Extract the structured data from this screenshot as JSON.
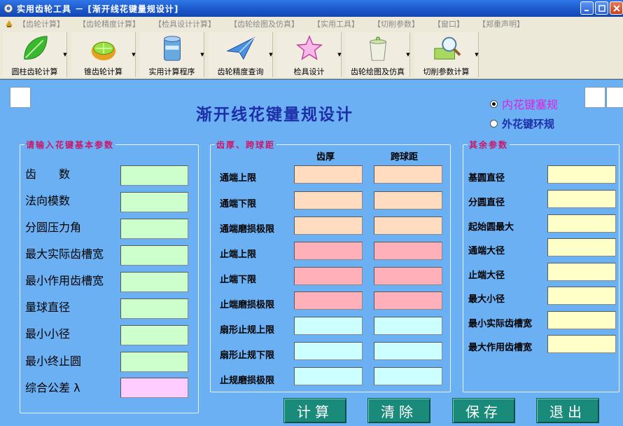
{
  "window": {
    "title": "实用齿轮工具 － [渐开线花键量规设计]",
    "colors": {
      "titlebar": "#1a56c9",
      "main_bg": "#6cb0f4",
      "title_text": "#1c2fa8"
    }
  },
  "menu": {
    "items": [
      "【齿轮计算】",
      "【齿轮精度计算】",
      "【检具设计计算】",
      "【齿轮绘图及仿真】",
      "【实用工具】",
      "【切削参数】",
      "【窗口】",
      "【郑重声明】"
    ]
  },
  "toolbar": {
    "buttons": [
      {
        "label": "圆柱齿轮计算",
        "icon": "green-leaf-icon"
      },
      {
        "label": "锥齿轮计算",
        "icon": "lime-fruit-icon"
      },
      {
        "label": "实用计算程序",
        "icon": "bin-icon"
      },
      {
        "label": "齿轮精度查询",
        "icon": "paper-plane-icon"
      },
      {
        "label": "检具设计",
        "icon": "star-icon"
      },
      {
        "label": "齿轮绘图及仿真",
        "icon": "cup-icon"
      },
      {
        "label": "切削参数计算",
        "icon": "magnifier-book-icon"
      }
    ]
  },
  "main": {
    "page_title": "渐开线花键量规设计",
    "radios": [
      {
        "label": "内花键塞规",
        "selected": true,
        "color": "#e020e0"
      },
      {
        "label": "外花键环规",
        "selected": false,
        "color": "#1c2fa8"
      }
    ]
  },
  "basic_params": {
    "title": "请输入花键基本参数",
    "fields": [
      "齿　　数",
      "法向模数",
      "分圆压力角",
      "最大实际齿槽宽",
      "最小作用齿槽宽",
      "量球直径",
      "最小小径",
      "最小终止圆",
      "综合公差 λ"
    ],
    "colors": {
      "input": "#ccffcc",
      "last_input": "#ffccff"
    }
  },
  "thickness": {
    "title": "齿厚、跨球距",
    "columns": [
      "齿厚",
      "跨球距"
    ],
    "rows": [
      "通端上限",
      "通端下限",
      "通端磨损极限",
      "止端上限",
      "止端下限",
      "止端磨损极限",
      "扇形止规上限",
      "扇形止规下限",
      "止规磨损极限"
    ],
    "colors": {
      "tan": "#ffdcc0",
      "pink": "#ffb0b8",
      "cyan": "#ccffff"
    }
  },
  "other_params": {
    "title": "其余参数",
    "fields": [
      "基圆直径",
      "分圆直径",
      "起始圆最大",
      "通端大径",
      "止端大径",
      "最大小径",
      "最小实际齿槽宽",
      "最大作用齿槽宽"
    ],
    "colors": {
      "input": "#ffffc8"
    }
  },
  "actions": [
    "计算",
    "清除",
    "保存",
    "退出"
  ]
}
